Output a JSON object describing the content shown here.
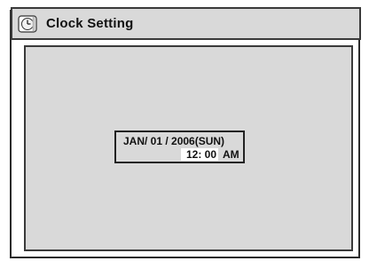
{
  "header": {
    "title": "Clock Setting",
    "icon": "clock-setting-icon"
  },
  "clock": {
    "date": "JAN/ 01 / 2006(SUN)",
    "time": "12: 00",
    "ampm": "AM"
  },
  "colors": {
    "panel_bg": "#d9d9d9",
    "border": "#3a3a3a",
    "highlight": "#ffffff",
    "text": "#111111"
  }
}
